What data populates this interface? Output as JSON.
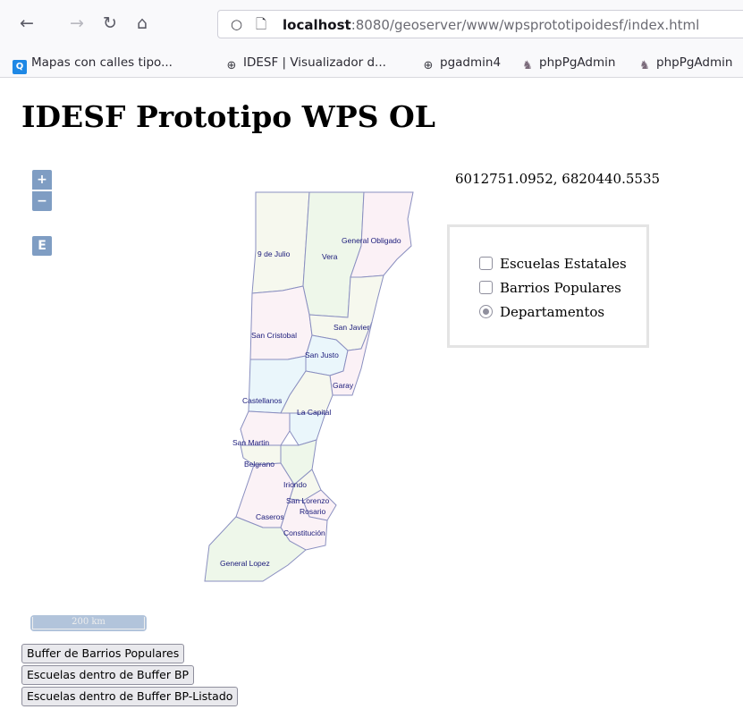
{
  "browser": {
    "url_host": "localhost",
    "url_rest": ":8080/geoserver/www/wpsprototipoidesf/index.html",
    "bookmarks": [
      {
        "label": "Mapas con calles tipo..."
      },
      {
        "label": "IDESF | Visualizador d..."
      },
      {
        "label": "pgadmin4"
      },
      {
        "label": "phpPgAdmin"
      },
      {
        "label": "phpPgAdmin"
      }
    ]
  },
  "page": {
    "title": "IDESF Prototipo WPS OL",
    "coordinates": "6012751.0952, 6820440.5535"
  },
  "map": {
    "zoom_in": "+",
    "zoom_out": "−",
    "e_button": "E",
    "scale": "200 km",
    "departments": [
      {
        "name": "9 de Julio"
      },
      {
        "name": "Vera"
      },
      {
        "name": "General Obligado"
      },
      {
        "name": "San Cristobal"
      },
      {
        "name": "San Javier"
      },
      {
        "name": "San Justo"
      },
      {
        "name": "Castellanos"
      },
      {
        "name": "Garay"
      },
      {
        "name": "La Capital"
      },
      {
        "name": "San Martin"
      },
      {
        "name": "Belgrano"
      },
      {
        "name": "Iriondo"
      },
      {
        "name": "San Lorenzo"
      },
      {
        "name": "Rosario"
      },
      {
        "name": "Caseros"
      },
      {
        "name": "Constitución"
      },
      {
        "name": "General Lopez"
      }
    ]
  },
  "layers": {
    "items": [
      {
        "label": "Escuelas Estatales",
        "type": "checkbox",
        "checked": false
      },
      {
        "label": "Barrios Populares",
        "type": "checkbox",
        "checked": false
      },
      {
        "label": "Departamentos",
        "type": "radio",
        "checked": true
      }
    ]
  },
  "buttons": {
    "buffer": "Buffer de Barrios Populares",
    "escuelas_buffer": "Escuelas dentro de Buffer BP",
    "escuelas_listado": "Escuelas dentro de Buffer BP-Listado"
  },
  "colors": {
    "ol_control": "#003c88",
    "dept_stroke": "#8a8fc0",
    "dept_label": "#1a1a7a"
  }
}
